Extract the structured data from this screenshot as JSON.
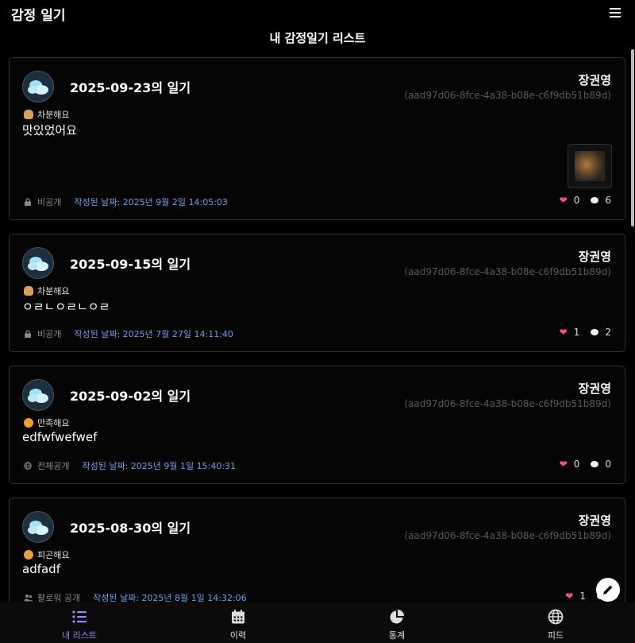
{
  "header": {
    "app_title": "감정 일기",
    "list_title": "내 감정일기 리스트"
  },
  "entries": [
    {
      "title": "2025-09-23의 일기",
      "author": "장권영",
      "uid": "(aad97d06-8fce-4a38-b08e-c6f9db51b89d)",
      "mood": "차분해요",
      "content": "맛있었어요",
      "has_photo": true,
      "visibility": "비공개",
      "created": "작성된 날짜: 2025년 9월 2일 14:05:03",
      "likes": "0",
      "comments": "6"
    },
    {
      "title": "2025-09-15의 일기",
      "author": "장권영",
      "uid": "(aad97d06-8fce-4a38-b08e-c6f9db51b89d)",
      "mood": "차분해요",
      "content": "ㅇㄹㄴㅇㄹㄴㅇㄹ",
      "has_photo": false,
      "visibility": "비공개",
      "created": "작성된 날짜: 2025년 7월 27일 14:11:40",
      "likes": "1",
      "comments": "2"
    },
    {
      "title": "2025-09-02의 일기",
      "author": "장권영",
      "uid": "(aad97d06-8fce-4a38-b08e-c6f9db51b89d)",
      "mood": "만족해요",
      "content": "edfwfwefwef",
      "has_photo": false,
      "visibility": "전체공개",
      "created": "작성된 날짜: 2025년 9월 1일 15:40:31",
      "likes": "0",
      "comments": "0"
    },
    {
      "title": "2025-08-30의 일기",
      "author": "장권영",
      "uid": "(aad97d06-8fce-4a38-b08e-c6f9db51b89d)",
      "mood": "피곤해요",
      "content": "adfadf",
      "has_photo": false,
      "visibility": "팔로워 공개",
      "created": "작성된 날짜: 2025년 8월 1일 14:32:06",
      "likes": "1",
      "comments": ""
    }
  ],
  "nav": {
    "items": [
      {
        "label": "내 리스트"
      },
      {
        "label": "이력"
      },
      {
        "label": "통계"
      },
      {
        "label": "피드"
      }
    ],
    "active_index": 0
  },
  "colors": {
    "accent": "#8b8cf8",
    "date": "#6ea0e8",
    "heart": "#ff4f7a",
    "background": "#000000"
  },
  "icons": {
    "menu": "hamburger-icon",
    "fab": "pencil-icon"
  }
}
